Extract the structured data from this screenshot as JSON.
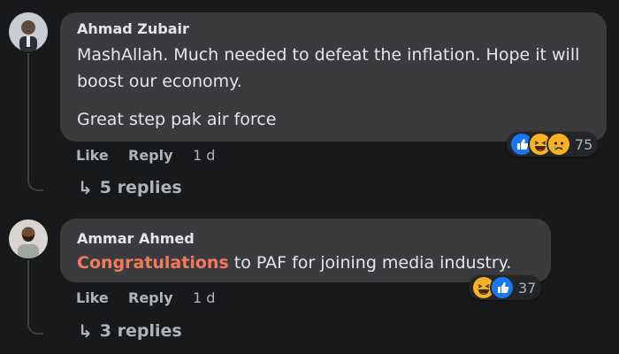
{
  "comments": [
    {
      "author": "Ahmad Zubair",
      "paragraphs": [
        "MashAllah. Much needed to defeat the inflation. Hope it will boost our economy.",
        "Great step pak air force"
      ],
      "reactions": [
        "like-icon",
        "haha-icon",
        "sad-icon"
      ],
      "reaction_count": "75",
      "like_label": "Like",
      "reply_label": "Reply",
      "timestamp": "1 d",
      "replies_label": "5 replies"
    },
    {
      "author": "Ammar Ahmed",
      "mention": "Congratulations",
      "text_rest": " to PAF for joining media industry.",
      "reactions": [
        "haha-icon",
        "like-icon"
      ],
      "reaction_count": "37",
      "like_label": "Like",
      "reply_label": "Reply",
      "timestamp": "1 d",
      "replies_label": "3 replies"
    }
  ],
  "colors": {
    "background": "#18191a",
    "bubble": "#3a3b3c",
    "text": "#e4e6eb",
    "muted": "#b0b3b8",
    "mention": "#f3795e",
    "like_blue": "#1877f2",
    "emoji_yellow": "#f7b125"
  }
}
